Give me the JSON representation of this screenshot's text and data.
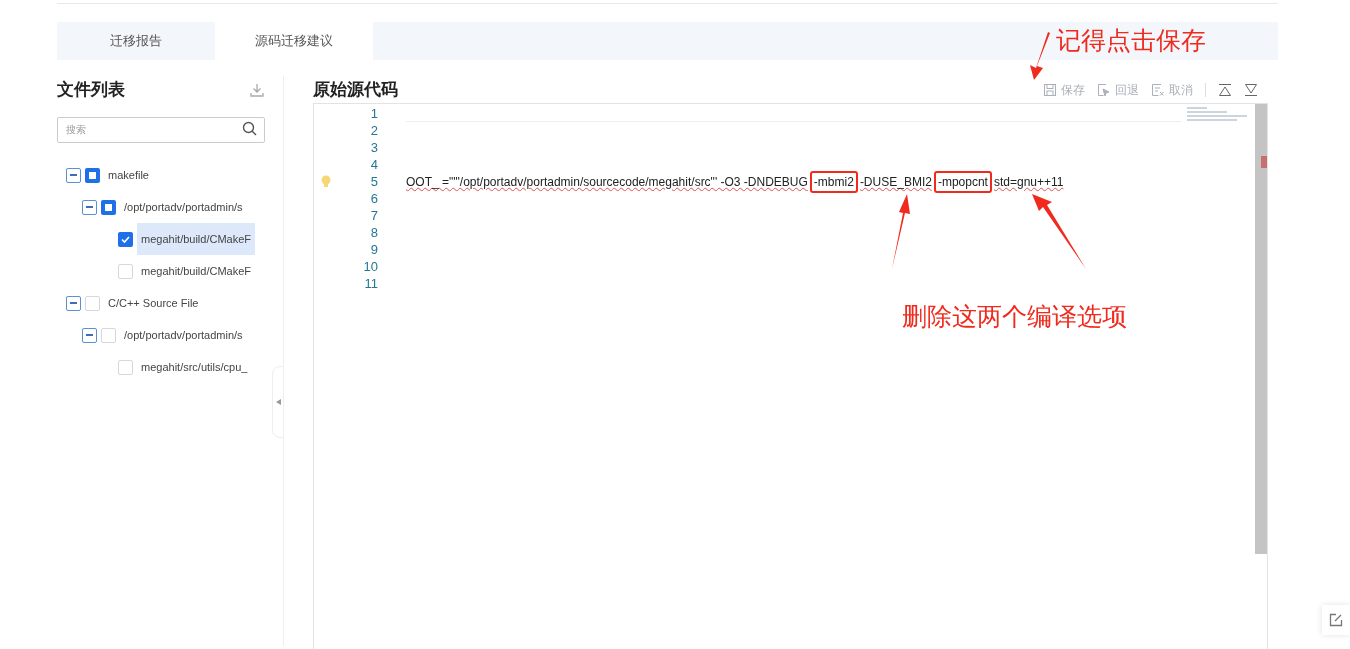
{
  "tabs": [
    {
      "label": "迁移报告",
      "selected": false
    },
    {
      "label": "源码迁移建议",
      "selected": true
    }
  ],
  "file_list": {
    "title": "文件列表",
    "search": {
      "placeholder": "搜索"
    },
    "tree": [
      {
        "label": "makefile",
        "indeterminate": true,
        "expanded": true,
        "selected": false,
        "children": [
          {
            "label": "/opt/portadv/portadmin/s",
            "indeterminate": true,
            "expanded": true,
            "selected": false,
            "children": [
              {
                "label": "megahit/build/CMakeF",
                "checked": true,
                "selected": true
              },
              {
                "label": "megahit/build/CMakeF",
                "checked": false,
                "selected": false
              }
            ]
          }
        ]
      },
      {
        "label": "C/C++ Source File",
        "checked": false,
        "indeterminate": false,
        "expanded": true,
        "selected": false,
        "children": [
          {
            "label": "/opt/portadv/portadmin/s",
            "checked": false,
            "indeterminate": false,
            "expanded": true,
            "selected": false,
            "children": [
              {
                "label": "megahit/src/utils/cpu_",
                "checked": false,
                "selected": false
              }
            ]
          }
        ]
      }
    ]
  },
  "editor": {
    "title": "原始源代码",
    "toolbar": [
      {
        "kind": "save",
        "label": "保存"
      },
      {
        "kind": "revert",
        "label": "回退"
      },
      {
        "kind": "cancel",
        "label": "取消"
      },
      {
        "kind": "up"
      },
      {
        "kind": "down"
      }
    ],
    "lines": [
      {
        "number": "1",
        "hint": false
      },
      {
        "number": "2",
        "hint": false
      },
      {
        "number": "3",
        "hint": false
      },
      {
        "number": "4",
        "hint": false
      },
      {
        "number": "5",
        "hint": true,
        "segments": [
          {
            "text": "OOT_ =\"'\"/opt/portadv/portadmin/sourcecode/megahit/src\"' -O3 -DNDEBUG ",
            "highlighted": false
          },
          {
            "text": "-mbmi2",
            "highlighted": true
          },
          {
            "text": "-DUSE_BMI2",
            "highlighted": false
          },
          {
            "text": "-mpopcnt",
            "highlighted": true
          },
          {
            "text": "std=gnu++11",
            "highlighted": false
          }
        ]
      },
      {
        "number": "6",
        "hint": false
      },
      {
        "number": "7",
        "hint": false
      },
      {
        "number": "8",
        "hint": false
      },
      {
        "number": "9",
        "hint": false
      },
      {
        "number": "10",
        "hint": false
      },
      {
        "number": "11",
        "hint": false
      }
    ]
  },
  "annotations": {
    "save_note": "记得点击保存",
    "delete_note": "删除这两个编译选项"
  }
}
